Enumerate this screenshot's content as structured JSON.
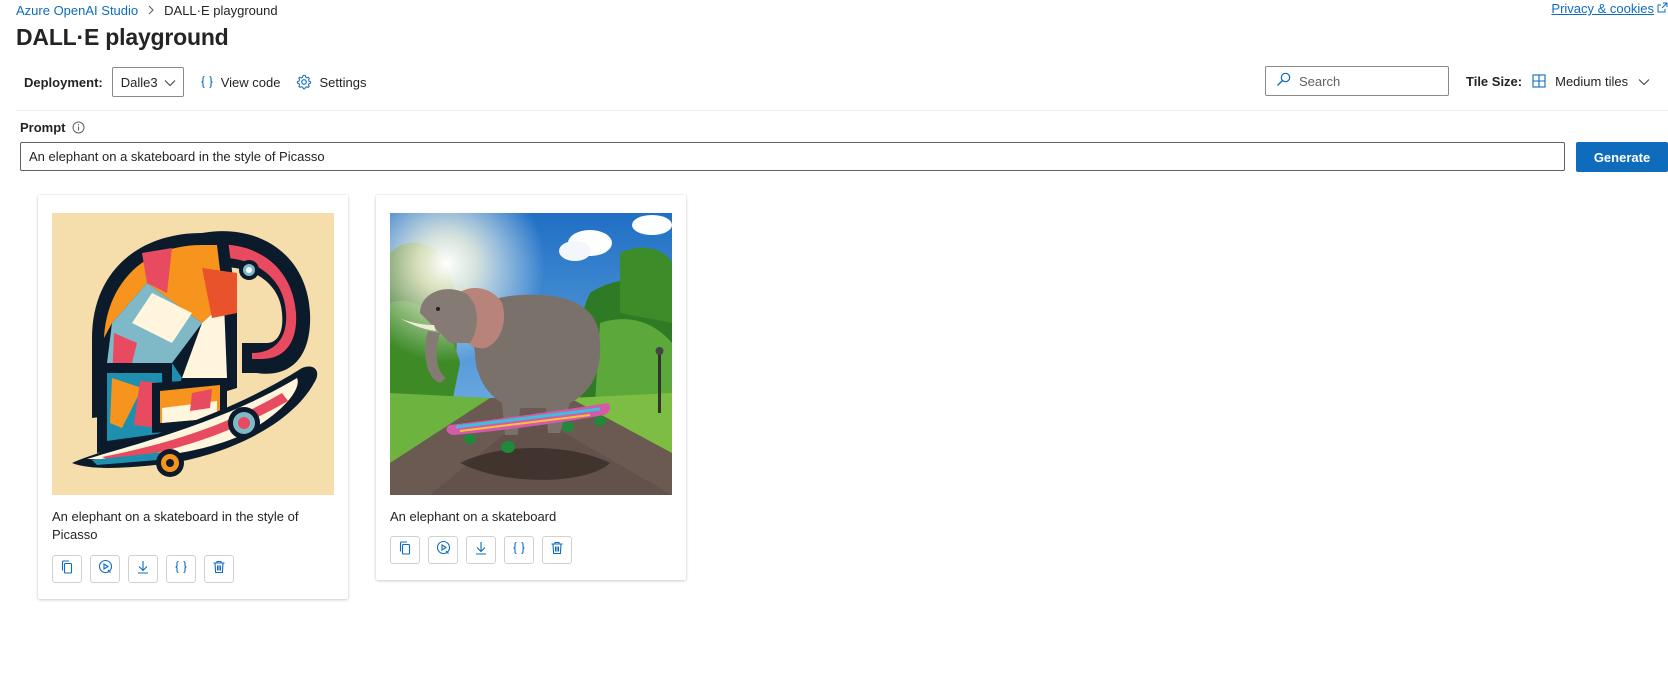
{
  "breadcrumb": {
    "root": "Azure OpenAI Studio",
    "current": "DALL·E playground"
  },
  "privacy_link": "Privacy & cookies",
  "page_title": "DALL·E playground",
  "toolbar": {
    "deployment_label": "Deployment:",
    "deployment_value": "Dalle3",
    "view_code": "View code",
    "settings": "Settings",
    "search_placeholder": "Search",
    "tile_size_label": "Tile Size:",
    "tile_size_value": "Medium tiles"
  },
  "prompt": {
    "label": "Prompt",
    "value": "An elephant on a skateboard in the style of Picasso",
    "generate": "Generate"
  },
  "images": [
    {
      "caption": "An elephant on a skateboard in the style of Picasso",
      "style": "abstract-cubist"
    },
    {
      "caption": "An elephant on a skateboard",
      "style": "photorealistic"
    }
  ],
  "icons": {
    "breadcrumb_separator": "chevron-right-icon",
    "external": "external-link-icon",
    "view_code": "code-braces-icon",
    "settings": "gear-icon",
    "search": "search-icon",
    "tile_size": "grid-icon",
    "info": "info-icon",
    "card_actions": [
      "copy-icon",
      "edit-image-icon",
      "download-icon",
      "code-braces-icon",
      "delete-icon"
    ]
  },
  "colors": {
    "accent": "#0f6cbd",
    "text": "#242424"
  }
}
